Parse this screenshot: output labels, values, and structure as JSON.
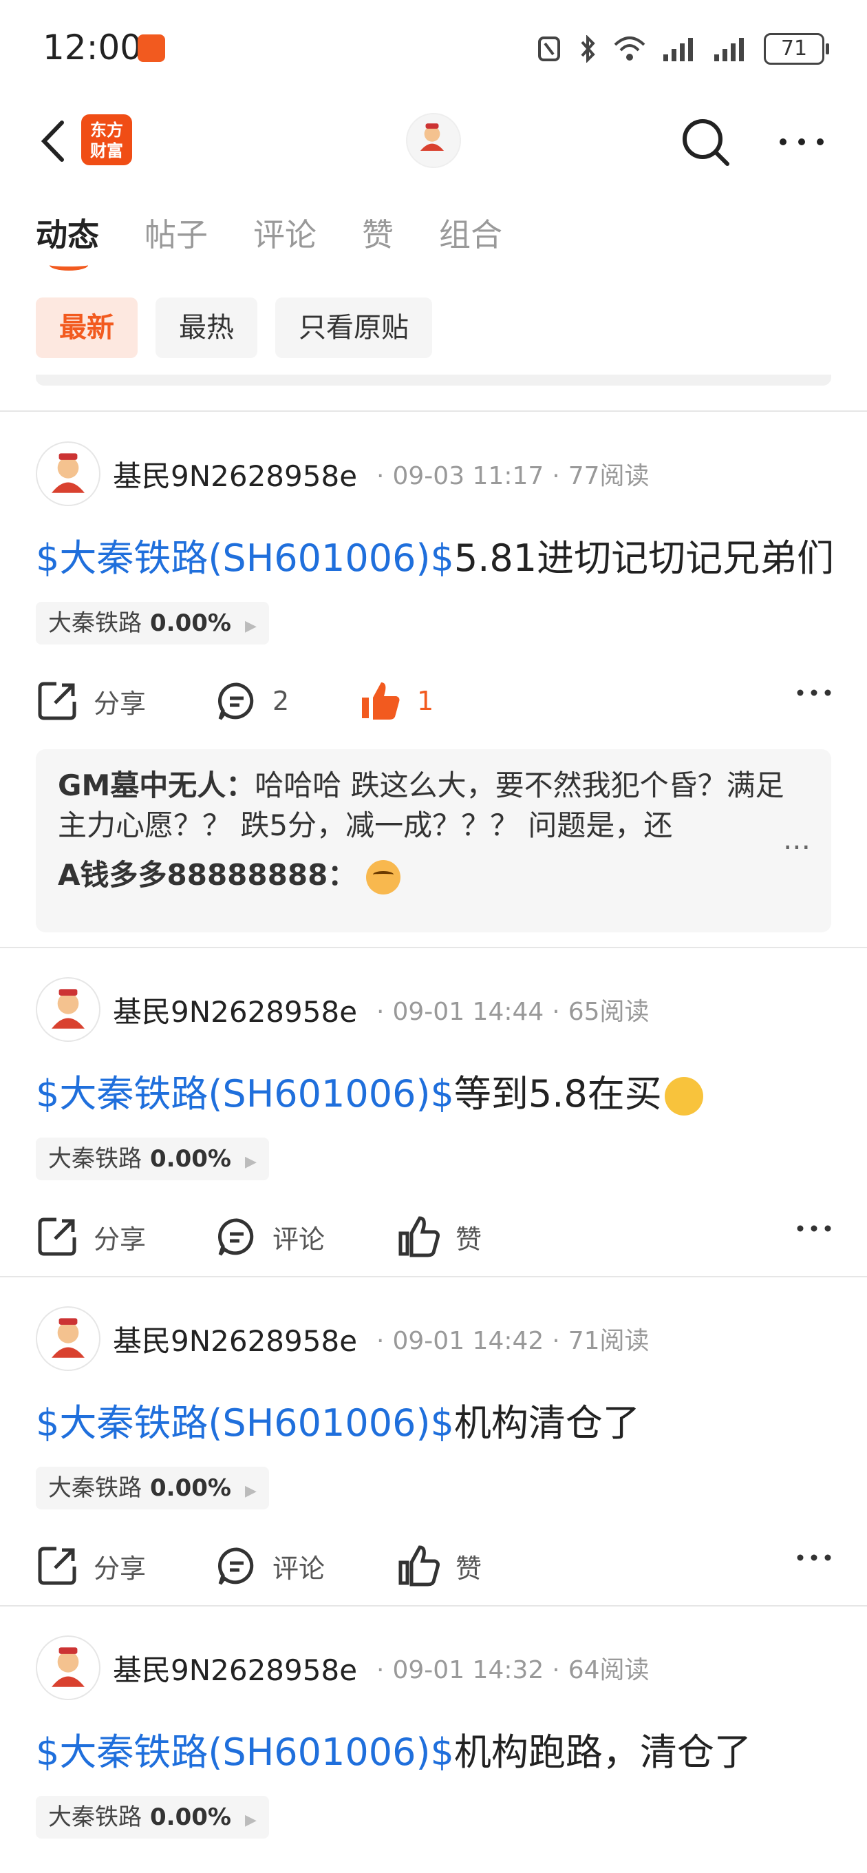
{
  "status_bar": {
    "time": "12:00",
    "battery": "71"
  },
  "header": {
    "brand": "东方\n财富"
  },
  "tabs": [
    "动态",
    "帖子",
    "评论",
    "赞",
    "组合"
  ],
  "filters": [
    "最新",
    "最热",
    "只看原贴"
  ],
  "posts": [
    {
      "author": "基民9N2628958e",
      "time": "09-03 11:17",
      "reads": "77阅读",
      "stock": "$大秦铁路(SH601006)$",
      "text": "5.81进切记切记兄弟们",
      "tag_name": "大秦铁路",
      "tag_pct": "0.00%",
      "share": "分享",
      "comment": "2",
      "like": "1",
      "comments": [
        {
          "name": "GM墓中无人：",
          "text": "哈哈哈 跌这么大，要不然我犯个昏？满足主力心愿？？ 跌5分，减一成？？？ 问题是，还"
        },
        {
          "name": "A钱多多88888888："
        }
      ],
      "more": "..."
    },
    {
      "author": "基民9N2628958e",
      "time": "09-01 14:44",
      "reads": "65阅读",
      "stock": "$大秦铁路(SH601006)$",
      "text": "等到5.8在买",
      "tag_name": "大秦铁路",
      "tag_pct": "0.00%",
      "share": "分享",
      "comment": "评论",
      "like": "赞"
    },
    {
      "author": "基民9N2628958e",
      "time": "09-01 14:42",
      "reads": "71阅读",
      "stock": "$大秦铁路(SH601006)$",
      "text": "机构清仓了",
      "tag_name": "大秦铁路",
      "tag_pct": "0.00%",
      "share": "分享",
      "comment": "评论",
      "like": "赞"
    },
    {
      "author": "基民9N2628958e",
      "time": "09-01 14:32",
      "reads": "64阅读",
      "stock": "$大秦铁路(SH601006)$",
      "text": "机构跑路，清仓了",
      "tag_name": "大秦铁路",
      "tag_pct": "0.00%"
    }
  ],
  "colors": {
    "accent": "#f25a1f",
    "link": "#1f6fdc"
  }
}
